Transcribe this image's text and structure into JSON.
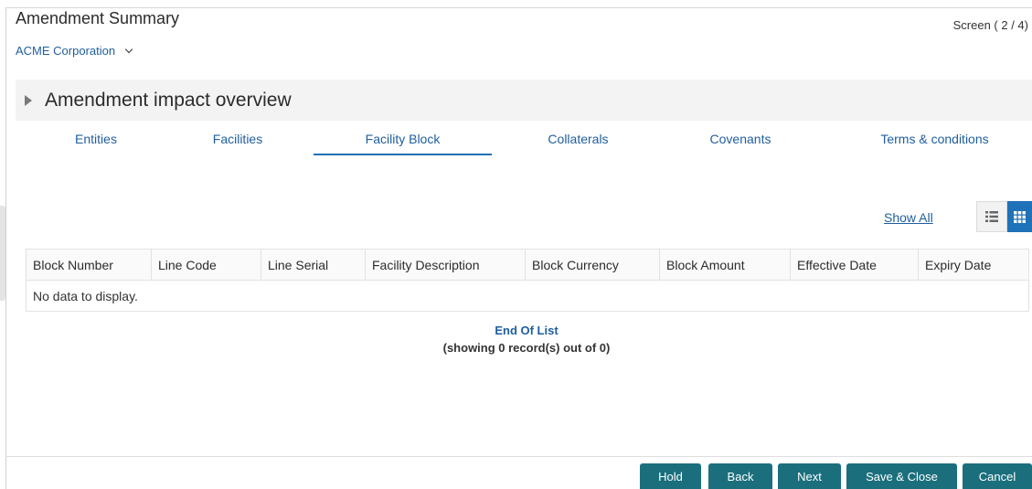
{
  "header": {
    "title": "Amendment Summary",
    "screen_indicator": "Screen ( 2 / 4)",
    "organization": "ACME Corporation"
  },
  "section": {
    "title": "Amendment impact overview"
  },
  "tabs": [
    {
      "label": "Entities"
    },
    {
      "label": "Facilities"
    },
    {
      "label": "Facility Block",
      "active": true
    },
    {
      "label": "Collaterals"
    },
    {
      "label": "Covenants"
    },
    {
      "label": "Terms & conditions"
    }
  ],
  "toolbar": {
    "show_all": "Show All",
    "list_view_icon": "list-view-icon",
    "grid_view_icon": "grid-view-icon"
  },
  "table": {
    "columns": [
      "Block Number",
      "Line Code",
      "Line Serial",
      "Facility Description",
      "Block Currency",
      "Block Amount",
      "Effective Date",
      "Expiry Date"
    ],
    "empty_message": "No data to display."
  },
  "list_footer": {
    "title": "End Of List",
    "count": "(showing 0 record(s) out of 0)"
  },
  "actions": {
    "hold": "Hold",
    "back": "Back",
    "next": "Next",
    "save_close": "Save & Close",
    "cancel": "Cancel"
  },
  "colors": {
    "link": "#1f5e9e",
    "accent": "#1f71b8",
    "button": "#1b6f7d"
  }
}
